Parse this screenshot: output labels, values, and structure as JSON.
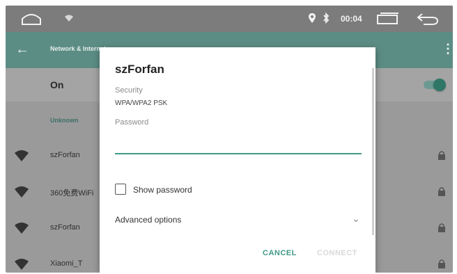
{
  "status_bar": {
    "time": "00:04",
    "icons": [
      "home-icon",
      "wifi-small-icon",
      "location-icon",
      "bluetooth-icon",
      "recents-icon",
      "back-icon"
    ]
  },
  "toolbar": {
    "title": "Network & Internet",
    "back_icon": "back-arrow-icon",
    "more_icon": "more-vert-icon"
  },
  "wifi_toggle": {
    "label": "On",
    "state": "on",
    "accent": "#2f7667"
  },
  "list": {
    "section_header": "Unknown",
    "networks": [
      {
        "name": "szForfan"
      },
      {
        "name": "360免费WiFi"
      },
      {
        "name": "szForfan"
      },
      {
        "name": "Xiaomi_T"
      }
    ]
  },
  "dialog": {
    "title": "szForfan",
    "security_label": "Security",
    "security_value": "WPA/WPA2 PSK",
    "password_label": "Password",
    "password_value": "",
    "show_password_label": "Show password",
    "show_password_checked": false,
    "advanced_label": "Advanced options",
    "cancel_label": "CANCEL",
    "connect_label": "CONNECT",
    "accent": "#3f9a86"
  }
}
